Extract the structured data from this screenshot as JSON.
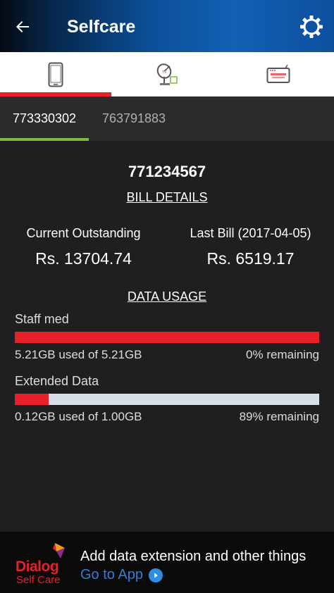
{
  "header": {
    "title": "Selfcare"
  },
  "number_tabs": [
    {
      "label": "773330302"
    },
    {
      "label": "763791883"
    }
  ],
  "account": {
    "number": "771234567",
    "bill_details_label": "BILL DETAILS",
    "current_outstanding_label": "Current Outstanding",
    "current_outstanding_value": "Rs. 13704.74",
    "last_bill_label": "Last Bill (2017-04-05)",
    "last_bill_value": "Rs. 6519.17"
  },
  "data_usage": {
    "label": "DATA USAGE",
    "items": [
      {
        "name": "Staff med",
        "used_text": "5.21GB used of 5.21GB",
        "remaining_text": "0% remaining",
        "used_fraction": 1.0
      },
      {
        "name": "Extended Data",
        "used_text": "0.12GB used of 1.00GB",
        "remaining_text": "89% remaining",
        "used_fraction": 0.11
      }
    ]
  },
  "banner": {
    "logo_brand": "Dialog",
    "logo_sub": "Self Care",
    "text": "Add data extension and other things",
    "cta": "Go to App"
  },
  "colors": {
    "accent_red": "#e8202a",
    "accent_green": "#7fba3a",
    "link_blue": "#2f7fd6"
  }
}
